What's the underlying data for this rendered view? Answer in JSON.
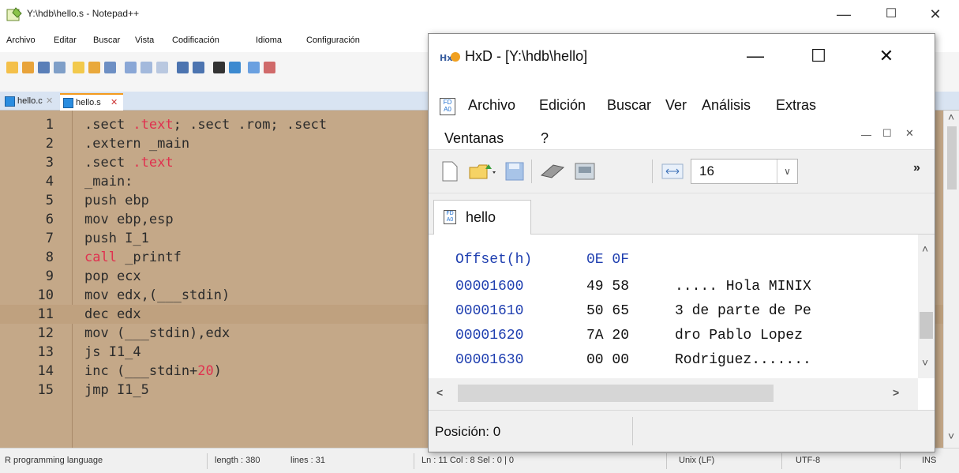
{
  "notepad": {
    "title": "Y:\\hdb\\hello.s - Notepad++",
    "menu": [
      "Archivo",
      "Editar",
      "Buscar",
      "Vista",
      "Codificación",
      "Idioma",
      "Configuración"
    ],
    "tabs": [
      {
        "label": "hello.c",
        "close": "✕"
      },
      {
        "label": "hello.s",
        "close": "✕"
      }
    ],
    "lines": [
      {
        "n": "1",
        "parts": [
          {
            "t": ".sect ",
            "kw": false
          },
          {
            "t": ".text",
            "kw": true
          },
          {
            "t": "; .sect .rom; .sect",
            "kw": false
          }
        ]
      },
      {
        "n": "2",
        "parts": [
          {
            "t": ".extern _main",
            "kw": false
          }
        ]
      },
      {
        "n": "3",
        "parts": [
          {
            "t": ".sect ",
            "kw": false
          },
          {
            "t": ".text",
            "kw": true
          }
        ]
      },
      {
        "n": "4",
        "parts": [
          {
            "t": "_main:",
            "kw": false
          }
        ]
      },
      {
        "n": "5",
        "parts": [
          {
            "t": "push ebp",
            "kw": false
          }
        ]
      },
      {
        "n": "6",
        "parts": [
          {
            "t": "mov ebp,esp",
            "kw": false
          }
        ]
      },
      {
        "n": "7",
        "parts": [
          {
            "t": "push I_1",
            "kw": false
          }
        ]
      },
      {
        "n": "8",
        "parts": [
          {
            "t": "call",
            "kw": true
          },
          {
            "t": " _printf",
            "kw": false
          }
        ]
      },
      {
        "n": "9",
        "parts": [
          {
            "t": "pop ecx",
            "kw": false
          }
        ]
      },
      {
        "n": "10",
        "parts": [
          {
            "t": "mov edx,(___stdin)",
            "kw": false
          }
        ]
      },
      {
        "n": "11",
        "parts": [
          {
            "t": "dec edx",
            "kw": false
          }
        ],
        "current": true
      },
      {
        "n": "12",
        "parts": [
          {
            "t": "mov (___stdin),edx",
            "kw": false
          }
        ]
      },
      {
        "n": "13",
        "parts": [
          {
            "t": "js I1_4",
            "kw": false
          }
        ]
      },
      {
        "n": "14",
        "parts": [
          {
            "t": "inc (___stdin+",
            "kw": false
          },
          {
            "t": "20",
            "kw": true
          },
          {
            "t": ")",
            "kw": false
          }
        ]
      },
      {
        "n": "15",
        "parts": [
          {
            "t": "jmp I1_5",
            "kw": false
          }
        ]
      }
    ],
    "status": {
      "lang": "R programming language",
      "length": "length : 380",
      "lines": "lines : 31",
      "pos": "Ln : 11    Col : 8    Sel : 0 | 0",
      "eol": "Unix (LF)",
      "enc": "UTF-8",
      "mode": "INS"
    }
  },
  "hxd": {
    "title": "HxD - [Y:\\hdb\\hello]",
    "menu": [
      "Archivo",
      "Edición",
      "Buscar",
      "Ver",
      "Análisis",
      "Extras"
    ],
    "menu2": [
      "Ventanas",
      "?"
    ],
    "bytes_per_row": "16",
    "tab": "hello",
    "header": {
      "offset": "Offset(h)",
      "cols": "0E 0F"
    },
    "rows": [
      {
        "offset": "00001600",
        "bytes": "49 58",
        "text": "..... Hola MINIX"
      },
      {
        "offset": "00001610",
        "bytes": "50 65",
        "text": "3 de parte de Pe"
      },
      {
        "offset": "00001620",
        "bytes": "7A 20",
        "text": "dro Pablo Lopez "
      },
      {
        "offset": "00001630",
        "bytes": "00 00",
        "text": "Rodriguez......."
      }
    ],
    "status": "Posición: 0"
  },
  "icons": {
    "minimize": "—",
    "maximize": "☐",
    "close": "✕",
    "chevron_down": "∨",
    "overflow": "»",
    "arrow_up": "˄",
    "arrow_down": "˅",
    "arrow_left": "<",
    "arrow_right": ">"
  },
  "colors": {
    "editor_bg": "#c4a888",
    "keyword": "#e0314f",
    "offset_blue": "#1f3fb0"
  }
}
